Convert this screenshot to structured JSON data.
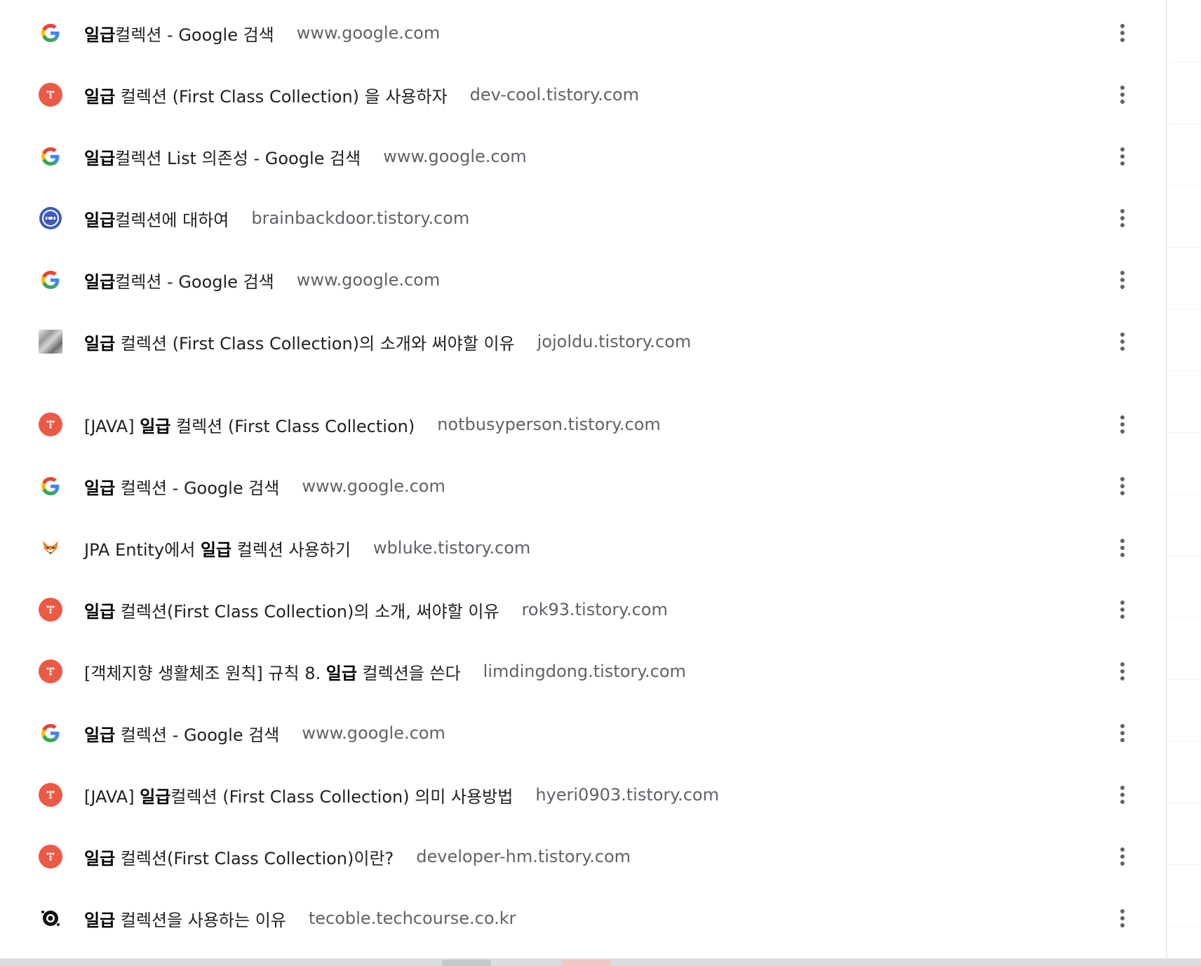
{
  "more_actions_glyph": "⋮",
  "colors": {
    "tistory_red": "#eb5a46",
    "domain_gray": "#5f6368",
    "title_black": "#202124"
  },
  "history": [
    {
      "icon": "google-g-icon",
      "bold": "일급",
      "rest": "컬렉션 - Google 검색",
      "domain": "www.google.com"
    },
    {
      "icon": "tistory-icon",
      "bold": "일급",
      "rest": " 컬렉션 (First Class Collection) 을 사용하자",
      "domain": "dev-cool.tistory.com"
    },
    {
      "icon": "google-g-icon",
      "bold": "일급",
      "rest": "컬렉션 List 의존성 - Google 검색",
      "domain": "www.google.com"
    },
    {
      "icon": "brainbackdoor-icon",
      "bold": "일급",
      "rest": "컬렉션에 대하여",
      "domain": "brainbackdoor.tistory.com"
    },
    {
      "icon": "google-g-icon",
      "bold": "일급",
      "rest": "컬렉션 - Google 검색",
      "domain": "www.google.com"
    },
    {
      "icon": "photo-icon",
      "bold": "일급",
      "rest": " 컬렉션 (First Class Collection)의 소개와 써야할 이유",
      "domain": "jojoldu.tistory.com"
    },
    {
      "icon": "tistory-icon",
      "pre": "[JAVA] ",
      "bold": "일급",
      "rest": " 컬렉션 (First Class Collection)",
      "domain": "notbusyperson.tistory.com"
    },
    {
      "icon": "google-g-icon",
      "bold": "일급",
      "rest": " 컬렉션 - Google 검색",
      "domain": "www.google.com"
    },
    {
      "icon": "fox-icon",
      "pre": "JPA Entity에서 ",
      "bold": "일급",
      "rest": " 컬렉션 사용하기",
      "domain": "wbluke.tistory.com"
    },
    {
      "icon": "tistory-icon",
      "bold": "일급",
      "rest": " 컬렉션(First Class Collection)의 소개, 써야할 이유",
      "domain": "rok93.tistory.com"
    },
    {
      "icon": "tistory-icon",
      "pre": "[객체지향 생활체조 원칙] 규칙 8. ",
      "bold": "일급",
      "rest": " 컬렉션을 쓴다",
      "domain": "limdingdong.tistory.com"
    },
    {
      "icon": "google-g-icon",
      "bold": "일급",
      "rest": " 컬렉션 - Google 검색",
      "domain": "www.google.com"
    },
    {
      "icon": "tistory-icon",
      "pre": "[JAVA] ",
      "bold": "일급",
      "rest": "컬렉션 (First Class Collection) 의미 사용방법",
      "domain": "hyeri0903.tistory.com"
    },
    {
      "icon": "tistory-icon",
      "bold": "일급",
      "rest": " 컬렉션(First Class Collection)이란?",
      "domain": "developer-hm.tistory.com"
    },
    {
      "icon": "tecoble-icon",
      "bold": "일급",
      "rest": " 컬렉션을 사용하는 이유",
      "domain": "tecoble.techcourse.co.kr"
    }
  ]
}
